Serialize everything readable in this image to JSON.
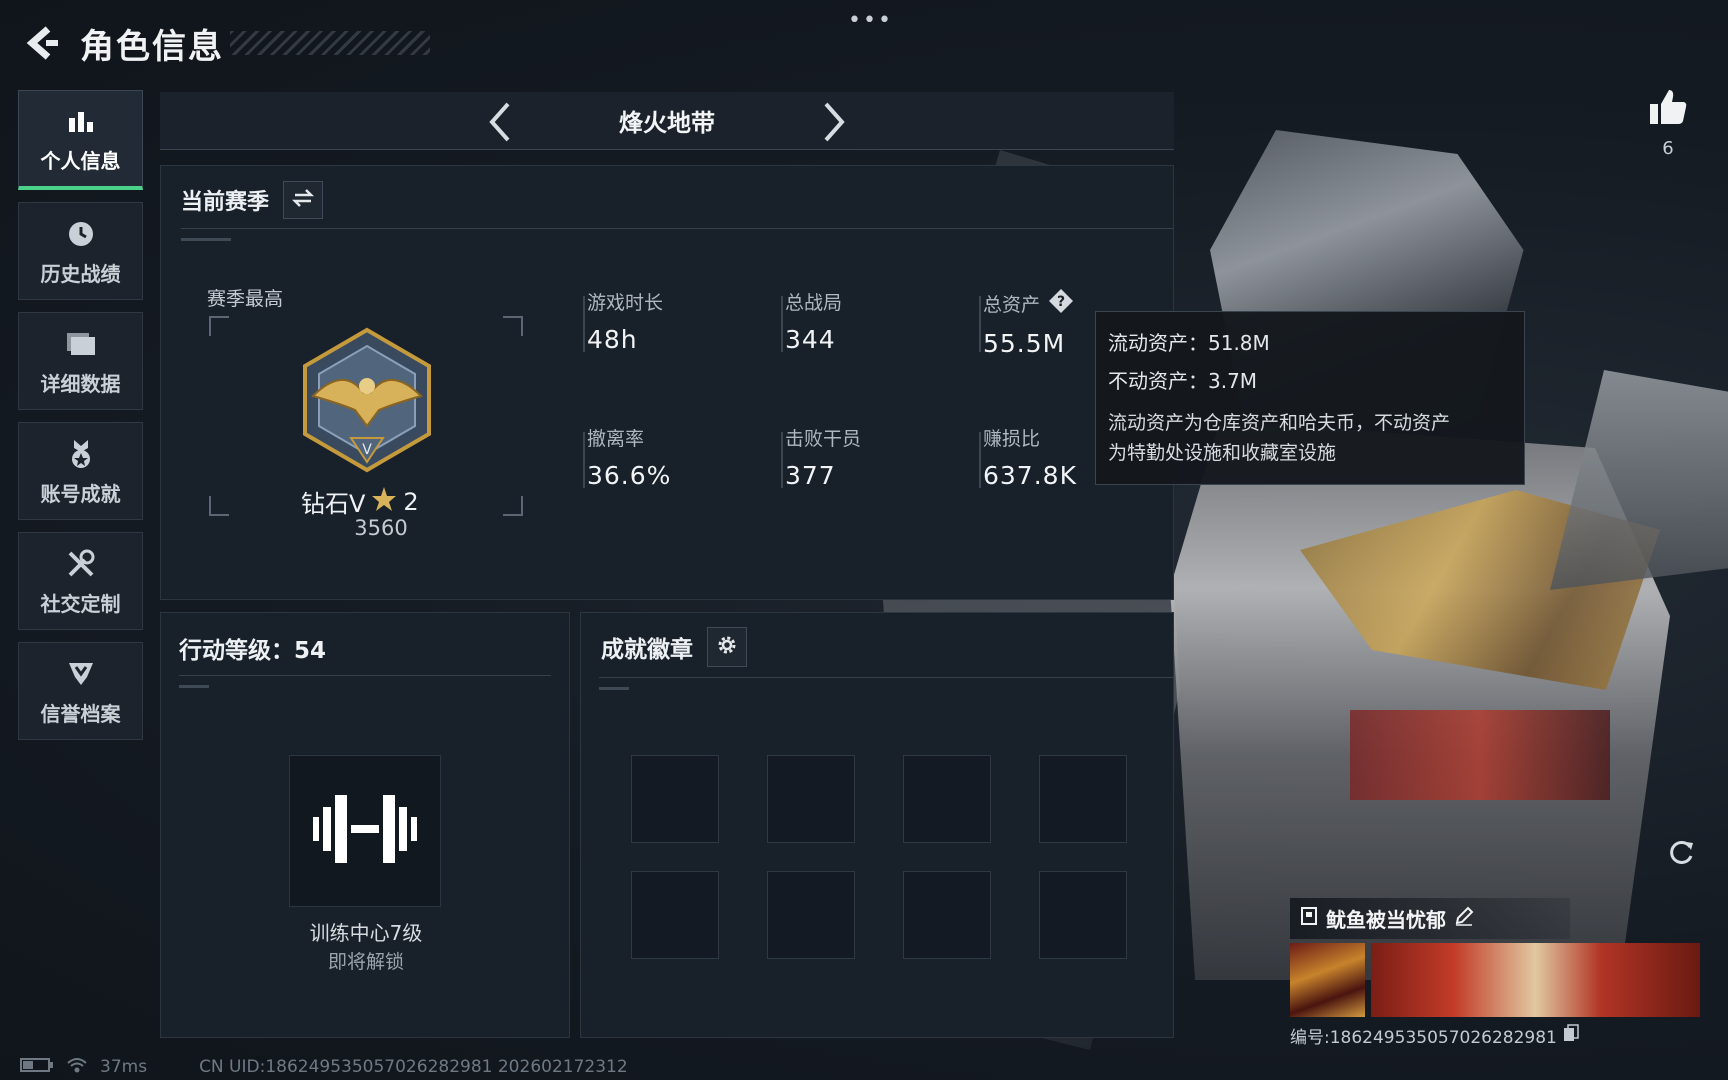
{
  "header": {
    "title": "角色信息"
  },
  "sidebar": {
    "items": [
      {
        "label": "个人信息",
        "icon": "bar-chart-icon",
        "active": true
      },
      {
        "label": "历史战绩",
        "icon": "clock-icon"
      },
      {
        "label": "详细数据",
        "icon": "folder-icon"
      },
      {
        "label": "账号成就",
        "icon": "achievement-medal-icon"
      },
      {
        "label": "社交定制",
        "icon": "tools-icon"
      },
      {
        "label": "信誉档案",
        "icon": "shield-badge-icon"
      }
    ]
  },
  "mode": {
    "title": "烽火地带"
  },
  "season": {
    "title": "当前赛季",
    "best_label": "赛季最高",
    "rank_name": "钻石V",
    "rank_stars": "2",
    "rank_score": "3560",
    "stats": {
      "play_time": {
        "label": "游戏时长",
        "value": "48h"
      },
      "total_matches": {
        "label": "总战局",
        "value": "344"
      },
      "total_assets": {
        "label": "总资产",
        "value": "55.5M"
      },
      "extract_rate": {
        "label": "撤离率",
        "value": "36.6%"
      },
      "kills": {
        "label": "击败干员",
        "value": "377"
      },
      "profit_ratio": {
        "label": "赚损比",
        "value": "637.8K"
      }
    }
  },
  "tooltip": {
    "liquid": "流动资产：51.8M",
    "fixed": "不动资产：3.7M",
    "desc_line1": "流动资产为仓库资产和哈夫币，不动资产",
    "desc_line2": "为特勤处设施和收藏室设施"
  },
  "level": {
    "title": "行动等级：54",
    "train_name": "训练中心7级",
    "train_sub": "即将解锁"
  },
  "badges": {
    "title": "成就徽章"
  },
  "likes": {
    "count": "6"
  },
  "card": {
    "name": "鱿鱼被当忧郁",
    "id": "编号:186249535057026282981"
  },
  "status": {
    "ping": "37ms",
    "uid": "CN UID:186249535057026282981 202602172312"
  },
  "colors": {
    "accent": "#4bd28a",
    "panel": "#18202a",
    "background": "#141a22"
  }
}
